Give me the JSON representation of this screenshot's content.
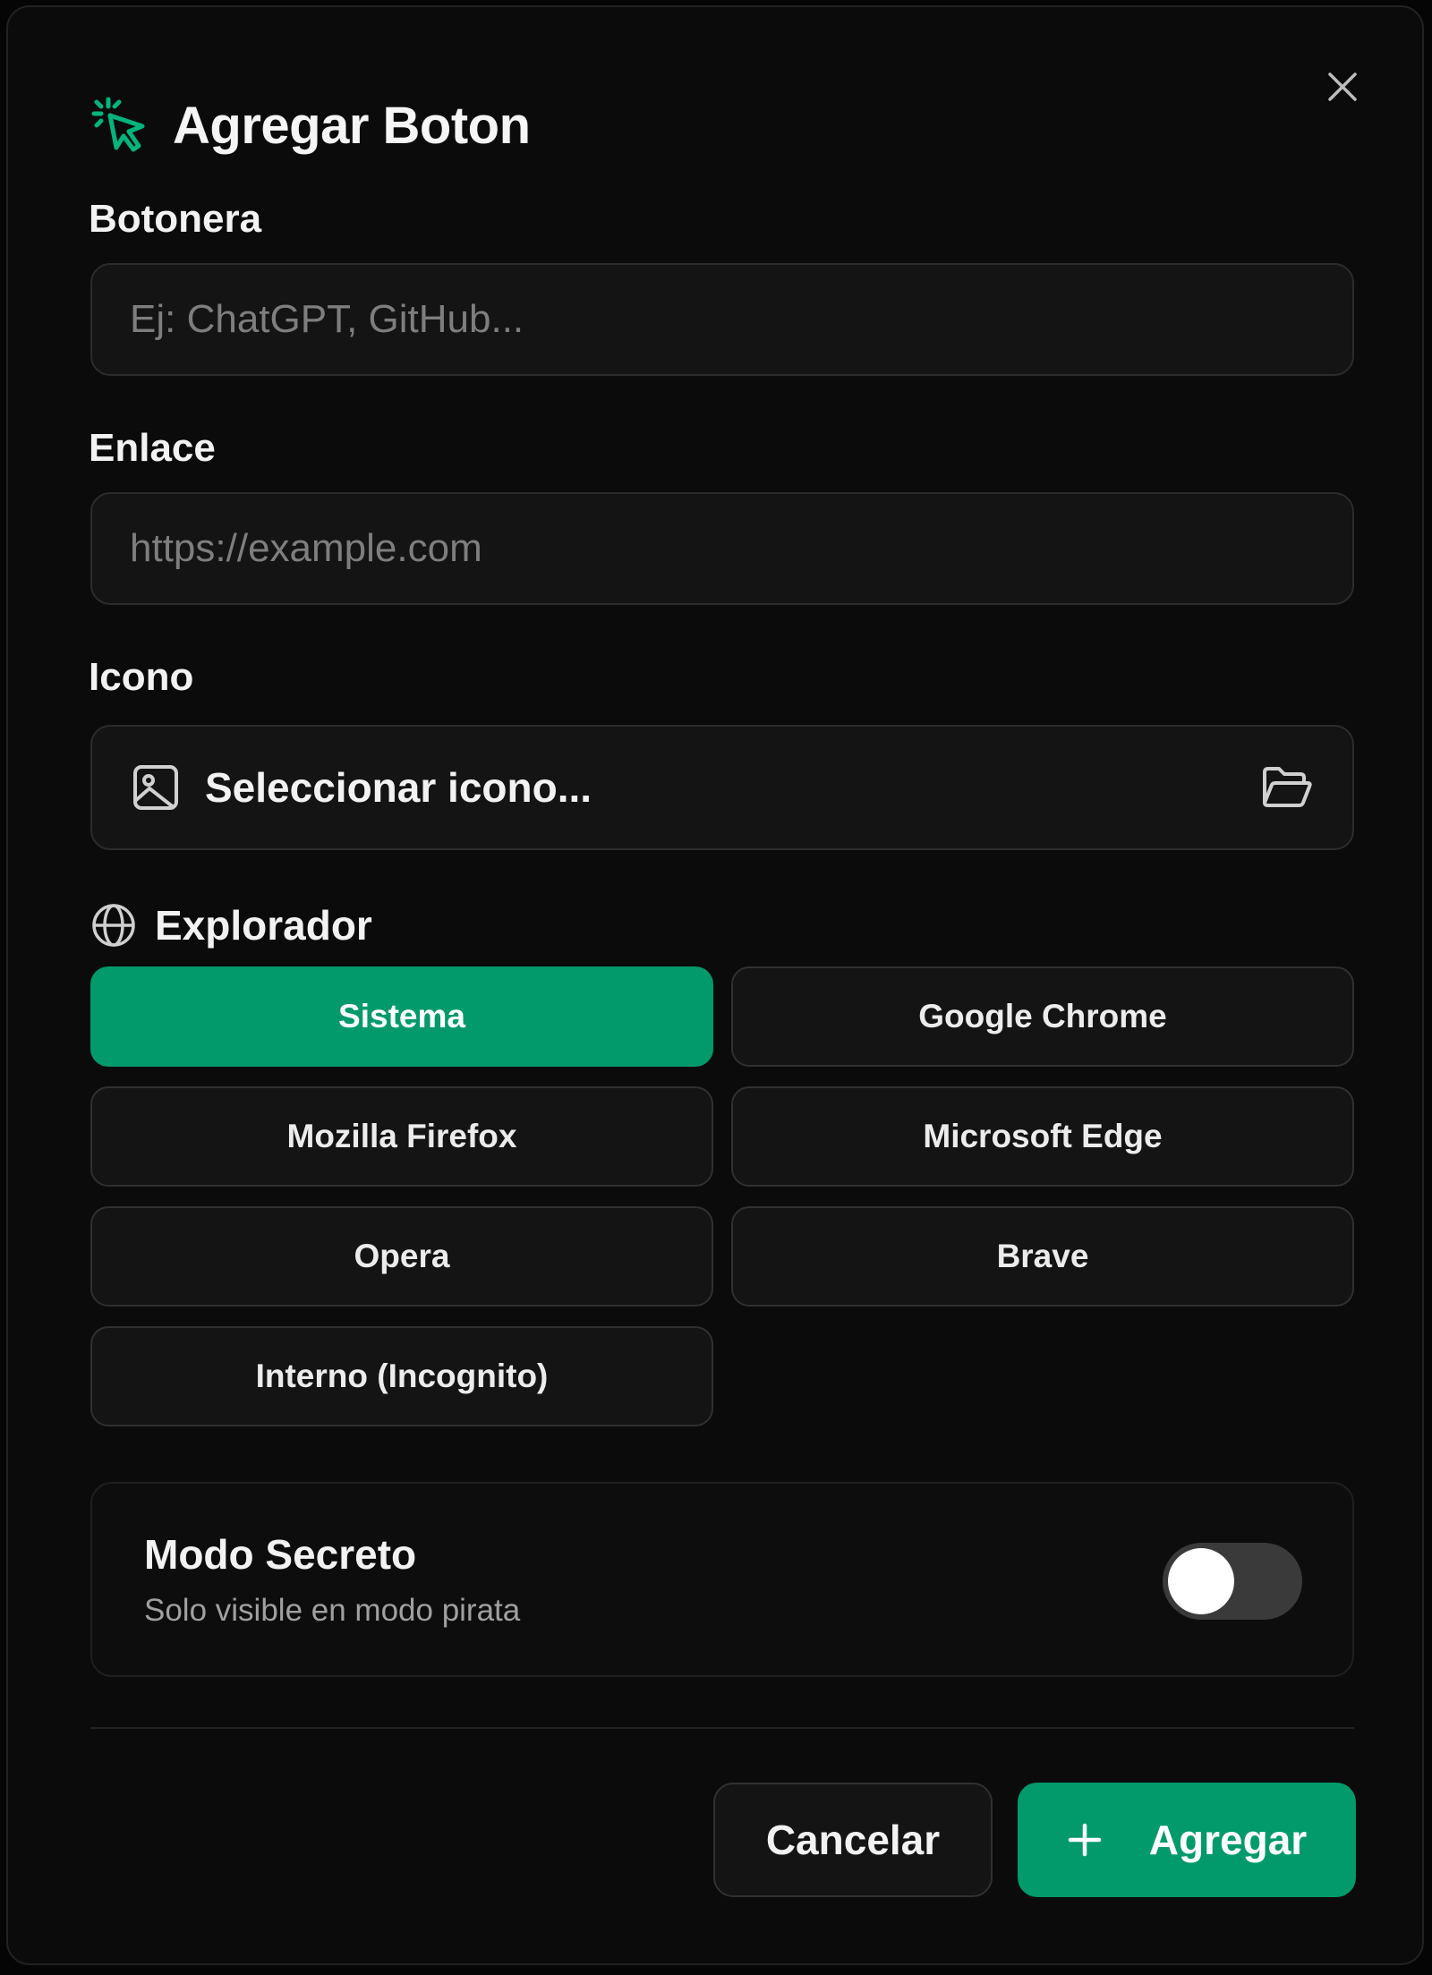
{
  "dialog": {
    "title": "Agregar Boton",
    "title_icon": "cursor-click-icon",
    "close_icon": "close-icon",
    "accent_color": "#02996b"
  },
  "fields": {
    "botonera": {
      "label": "Botonera",
      "value": "",
      "placeholder": "Ej: ChatGPT, GitHub..."
    },
    "enlace": {
      "label": "Enlace",
      "value": "",
      "placeholder": "https://example.com"
    },
    "icono": {
      "label": "Icono",
      "button_text": "Seleccionar icono...",
      "leading_icon": "image-icon",
      "trailing_icon": "folder-open-icon"
    }
  },
  "explorador": {
    "label": "Explorador",
    "icon": "globe-icon",
    "options": [
      {
        "label": "Sistema",
        "selected": true
      },
      {
        "label": "Google Chrome",
        "selected": false
      },
      {
        "label": "Mozilla Firefox",
        "selected": false
      },
      {
        "label": "Microsoft Edge",
        "selected": false
      },
      {
        "label": "Opera",
        "selected": false
      },
      {
        "label": "Brave",
        "selected": false
      },
      {
        "label": "Interno (Incognito)",
        "selected": false
      }
    ]
  },
  "secret_mode": {
    "title": "Modo Secreto",
    "subtitle": "Solo visible en modo pirata",
    "enabled": false
  },
  "footer": {
    "cancel_label": "Cancelar",
    "add_label": "Agregar",
    "add_icon": "plus-icon"
  }
}
